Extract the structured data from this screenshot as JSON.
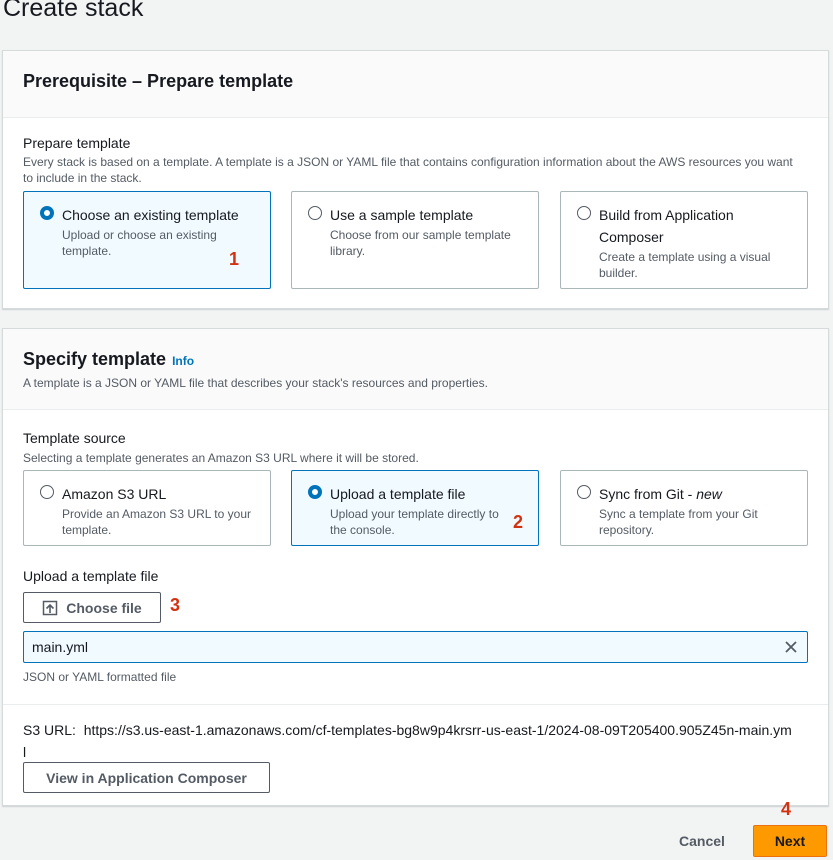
{
  "page": {
    "title": "Create stack"
  },
  "prerequisite": {
    "header": "Prerequisite – Prepare template",
    "label": "Prepare template",
    "description": "Every stack is based on a template. A template is a JSON or YAML file that contains configuration information about the AWS resources you want to include in the stack.",
    "options": [
      {
        "title": "Choose an existing template",
        "desc": "Upload or choose an existing template.",
        "selected": true
      },
      {
        "title": "Use a sample template",
        "desc": "Choose from our sample template library.",
        "selected": false
      },
      {
        "title": "Build from Application Composer",
        "desc": "Create a template using a visual builder.",
        "selected": false
      }
    ]
  },
  "specify": {
    "header": "Specify template",
    "info": "Info",
    "header_desc": "A template is a JSON or YAML file that describes your stack's resources and properties.",
    "source_label": "Template source",
    "source_desc": "Selecting a template generates an Amazon S3 URL where it will be stored.",
    "options": [
      {
        "title": "Amazon S3 URL",
        "desc": "Provide an Amazon S3 URL to your template.",
        "selected": false
      },
      {
        "title": "Upload a template file",
        "desc": "Upload your template directly to the console.",
        "selected": true
      },
      {
        "title_main": "Sync from Git - ",
        "title_em": "new",
        "desc": "Sync a template from your Git repository.",
        "selected": false
      }
    ],
    "upload_label": "Upload a template file",
    "choose_file": "Choose file",
    "file_value": "main.yml",
    "file_hint": "JSON or YAML formatted file",
    "s3_label": "S3 URL:",
    "s3_url": "https://s3.us-east-1.amazonaws.com/cf-templates-bg8w9p4krsrr-us-east-1/2024-08-09T205400.905Z45n-main.yml",
    "composer_button": "View in Application Composer"
  },
  "annotations": {
    "step1": "1",
    "step2": "2",
    "step3": "3",
    "step4": "4"
  },
  "footer": {
    "cancel": "Cancel",
    "next": "Next"
  },
  "colors": {
    "accent": "#0073bb",
    "primary": "#ff9900",
    "annotation": "#d13212"
  }
}
